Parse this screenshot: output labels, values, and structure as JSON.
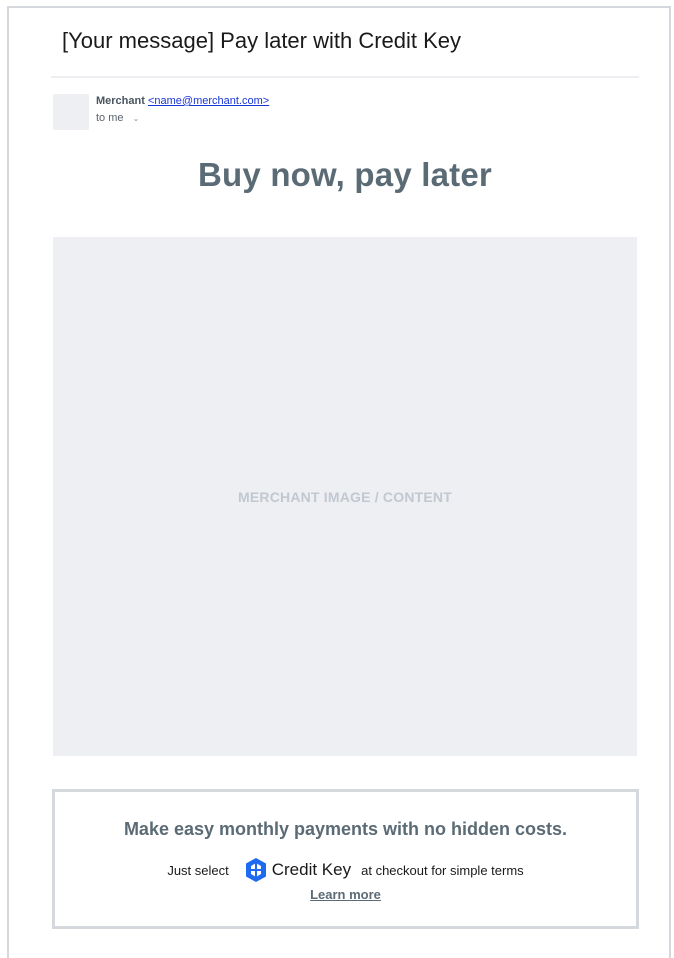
{
  "email": {
    "subject": "[Your message] Pay later with Credit Key",
    "sender": {
      "name": "Merchant",
      "email": "<name@merchant.com>"
    },
    "recipient": "to me",
    "headline": "Buy now, pay later",
    "merchant_placeholder": "MERCHANT IMAGE / CONTENT"
  },
  "promo": {
    "title": "Make easy monthly payments with no hidden costs.",
    "pre_text": "Just select",
    "brand_name": "Credit Key",
    "post_text": "at checkout for simple terms",
    "learn_more": "Learn more"
  },
  "icons": {
    "recipient_toggle": "chevron-down-icon",
    "brand_logo": "credit-key-logo-icon"
  },
  "colors": {
    "headline": "#5b6b75",
    "link": "#1a35d6",
    "brand_blue": "#1e6bf0",
    "placeholder_bg": "#eeeff3",
    "border": "#d5d9de"
  }
}
